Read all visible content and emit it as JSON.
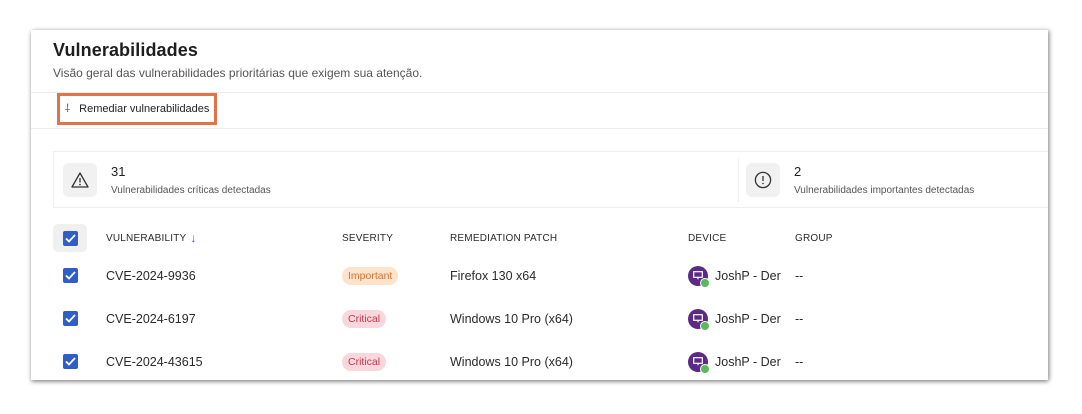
{
  "header": {
    "title": "Vulnerabilidades",
    "subtitle": "Visão geral das vulnerabilidades prioritárias que exigem sua atenção."
  },
  "action": {
    "label": "Remediar vulnerabilidades",
    "icon": "download-arrow-icon",
    "highlight_color": "#e0734a"
  },
  "stats": [
    {
      "value": "31",
      "label": "Vulnerabilidades críticas detectadas",
      "icon": "warning-triangle-icon"
    },
    {
      "value": "2",
      "label": "Vulnerabilidades importantes detectadas",
      "icon": "exclamation-circle-icon"
    }
  ],
  "table": {
    "columns": {
      "vulnerability": "VULNERABILITY",
      "severity": "SEVERITY",
      "patch": "REMEDIATION PATCH",
      "device": "DEVICE",
      "group": "GROUP"
    },
    "sort_indicator": "↓",
    "rows": [
      {
        "vulnerability": "CVE-2024-9936",
        "severity": "Important",
        "patch": "Firefox 130 x64",
        "device": "JoshP - Der",
        "group": "--"
      },
      {
        "vulnerability": "CVE-2024-6197",
        "severity": "Critical",
        "patch": "Windows 10 Pro (x64)",
        "device": "JoshP - Der",
        "group": "--"
      },
      {
        "vulnerability": "CVE-2024-43615",
        "severity": "Critical",
        "patch": "Windows 10 Pro (x64)",
        "device": "JoshP - Der",
        "group": "--"
      }
    ]
  },
  "colors": {
    "checkbox": "#2f5fc6",
    "important_badge_bg": "#fde3cc",
    "important_badge_text": "#d4712f",
    "critical_badge_bg": "#f8d8dc",
    "critical_badge_text": "#c8364d",
    "device_icon": "#5b2a86",
    "online_dot": "#5cb85c"
  }
}
